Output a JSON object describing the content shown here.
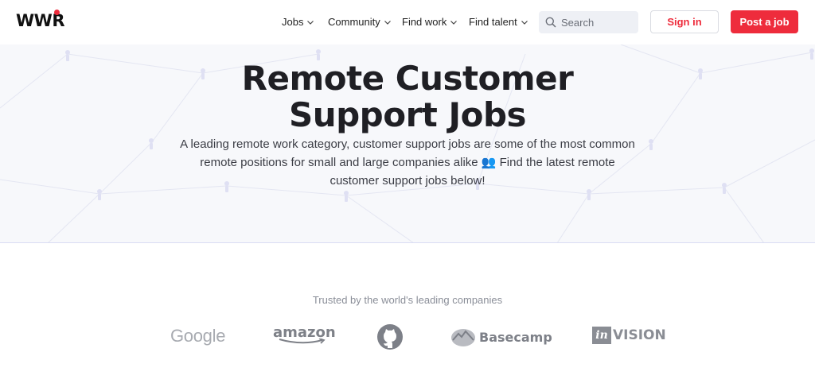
{
  "header": {
    "logo": "WWR",
    "nav": [
      {
        "label": "Jobs"
      },
      {
        "label": "Community"
      },
      {
        "label": "Find work"
      },
      {
        "label": "Find talent"
      }
    ],
    "search": {
      "placeholder": "Search"
    },
    "sign_in": "Sign in",
    "post_job": "Post a job"
  },
  "hero": {
    "title_line1": "Remote Customer",
    "title_line2": "Support Jobs",
    "description": "A leading remote work category, customer support jobs are some of the most common remote positions for small and large companies alike 👥 Find the latest remote customer support jobs below!"
  },
  "trusted": {
    "label": "Trusted by the world's leading companies",
    "logos": [
      "Google",
      "amazon",
      "github",
      "Basecamp",
      "InVision"
    ],
    "basecamp_text": "Basecamp",
    "invision_box": "in",
    "invision_text": "VISION"
  },
  "colors": {
    "brand_red": "#ee2c3c",
    "text_dark": "#1f1f24"
  },
  "icons": {
    "search": "search-icon",
    "chevron": "chevron-down-icon"
  }
}
